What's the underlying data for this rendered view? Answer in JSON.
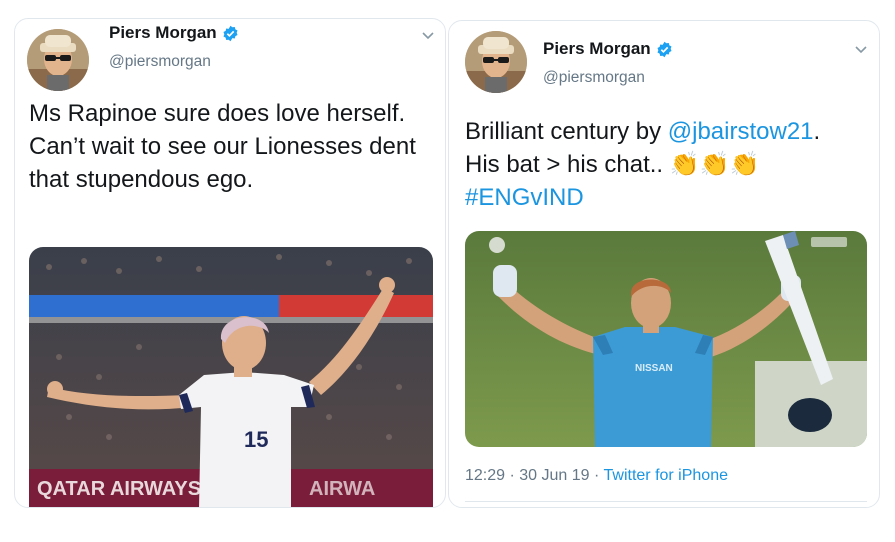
{
  "left_tweet": {
    "author_name": "Piers Morgan",
    "author_handle": "@piersmorgan",
    "text": "Ms Rapinoe sure does love herself. Can’t wait to see our Lionesses dent that stupendous ego.",
    "media": {
      "jersey_number": "15",
      "sponsor_banner": "QATAR AIRWAYS"
    }
  },
  "right_tweet": {
    "author_name": "Piers Morgan",
    "author_handle": "@piersmorgan",
    "text_before_mention": "Brilliant century by ",
    "mention": "@jbairstow21",
    "text_after_mention": ".",
    "line2": "His bat > his chat..",
    "emoji": "👏👏👏",
    "hashtag": "#ENGvIND",
    "meta": {
      "time": "12:29",
      "separator": "·",
      "date": "30 Jun 19",
      "source": "Twitter for iPhone"
    }
  },
  "icons": {
    "verified": "verified-badge-icon",
    "menu": "chevron-down-icon"
  },
  "colors": {
    "link": "#1b95e0",
    "secondary_text": "#657786",
    "verified": "#1da1f2"
  }
}
